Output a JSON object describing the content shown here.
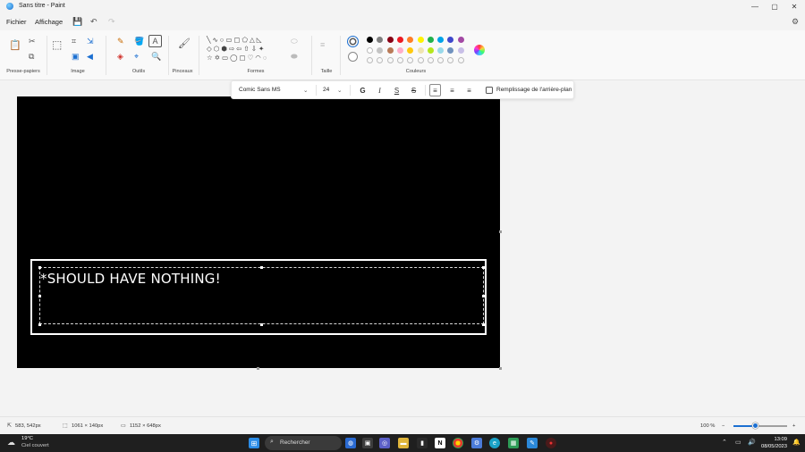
{
  "window": {
    "title": "Sans titre - Paint",
    "controls": {
      "minimize": "—",
      "maximize": "▢",
      "close": "✕"
    }
  },
  "menu": {
    "file": "Fichier",
    "view": "Affichage"
  },
  "ribbon": {
    "groups": {
      "clipboard": "Presse-papiers",
      "image": "Image",
      "tools": "Outils",
      "brushes": "Pinceaux",
      "shapes": "Formes",
      "size": "Taille",
      "colors": "Couleurs"
    },
    "palette_row1": [
      "#000000",
      "#7f7f7f",
      "#880015",
      "#ed1c24",
      "#ff7f27",
      "#fff200",
      "#22b14c",
      "#00a2e8",
      "#3f48cc",
      "#a349a4"
    ],
    "palette_row2": [
      "#ffffff",
      "#c3c3c3",
      "#b97a57",
      "#ffaec9",
      "#ffc90e",
      "#efe4b0",
      "#b5e61d",
      "#99d9ea",
      "#7092be",
      "#c8bfe7"
    ]
  },
  "text_toolbar": {
    "font": "Comic Sans MS",
    "size": "24",
    "bold": "G",
    "italic": "I",
    "underline": "S",
    "strike": "S",
    "background_fill_label": "Remplissage de l'arrière-plan"
  },
  "canvas": {
    "text": "*SHOULD HAVE NOTHING!"
  },
  "status": {
    "cursor": "583, 542px",
    "selection": "1061 × 140px",
    "canvas_size": "1152 × 648px",
    "zoom": "100 %",
    "zoom_fraction": 0.4
  },
  "taskbar": {
    "weather_temp": "19°C",
    "weather_desc": "Ciel couvert",
    "search": "Rechercher",
    "time": "13:09",
    "date": "08/05/2023"
  }
}
